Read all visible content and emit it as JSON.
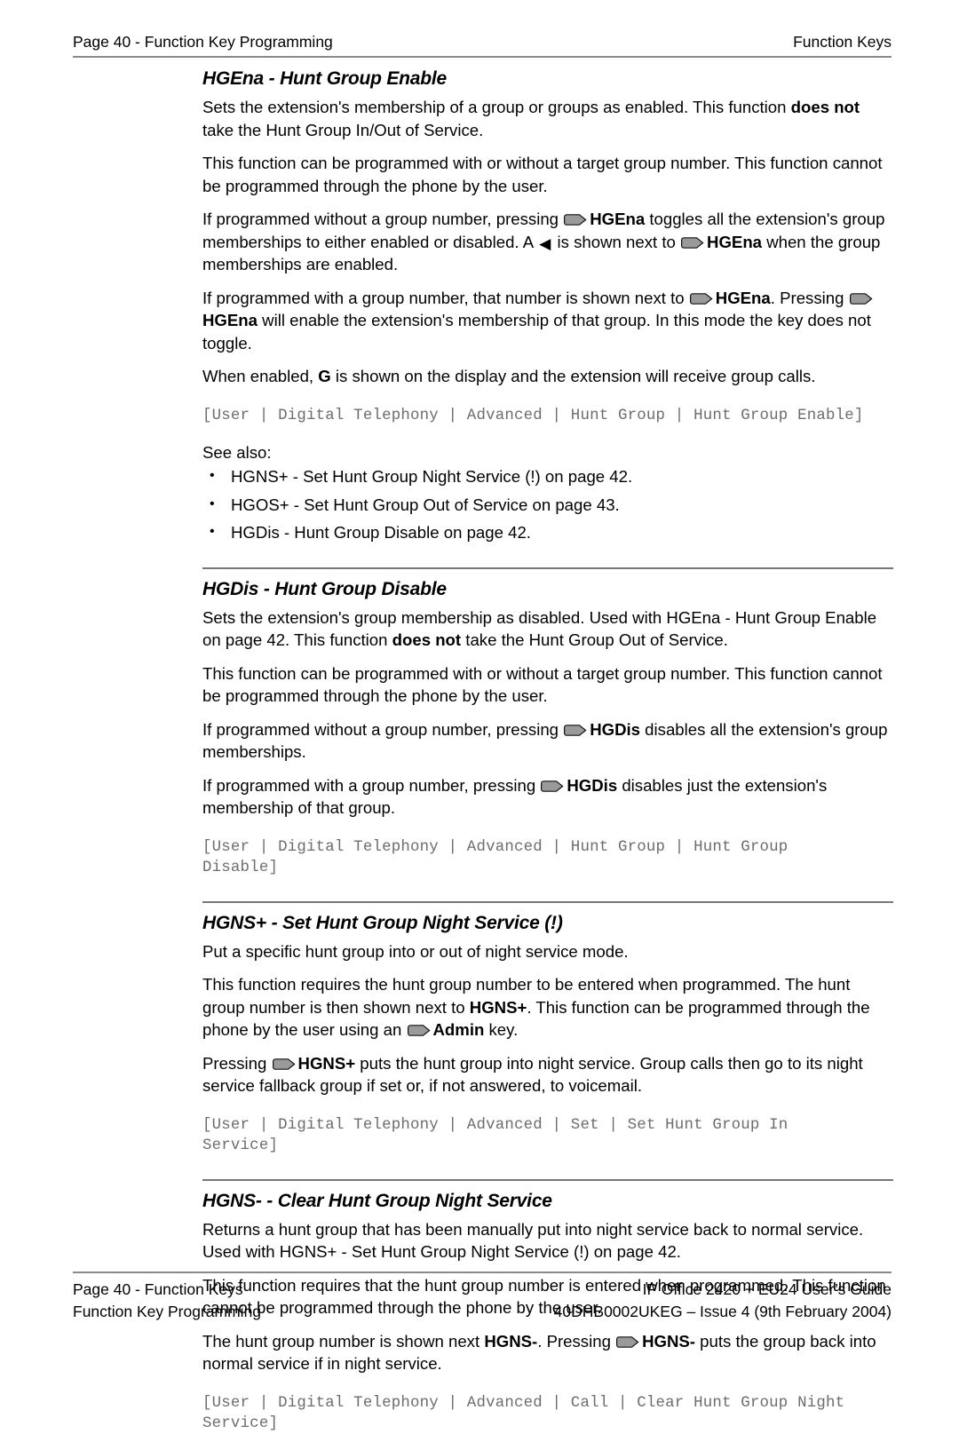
{
  "header": {
    "left": "Page 40 - Function Key Programming",
    "right": "Function Keys"
  },
  "icons": {
    "key": "phone-key-icon",
    "left_arrow": "◀"
  },
  "sections": [
    {
      "title": "HGEna - Hunt Group Enable",
      "p1_a": "Sets the extension's membership of a group or groups as enabled. This function ",
      "p1_b": "does not",
      "p1_c": " take the Hunt Group In/Out of Service.",
      "p2": "This function can be programmed with or without a target group number. This function cannot be programmed through the phone by the user.",
      "p3_a": "If programmed without a group number, pressing ",
      "p3_b": "HGEna",
      "p3_c": " toggles all the extension's group memberships to either enabled or disabled. A ",
      "p3_d": " is shown next to ",
      "p3_e": "HGEna",
      "p3_f": " when the group memberships are enabled.",
      "p4_a": "If programmed with a group number, that number is shown next to ",
      "p4_b": "HGEna",
      "p4_c": ". Pressing ",
      "p4_d": "HGEna",
      "p4_e": " will enable the extension's membership of that group. In this mode the key does not toggle.",
      "p5_a": "When enabled, ",
      "p5_b": "G",
      "p5_c": " is shown on the display and the extension will receive group calls.",
      "path": "[User | Digital Telephony | Advanced | Hunt Group | Hunt Group Enable]",
      "see_also_label": "See also:",
      "see_also": [
        "HGNS+ - Set Hunt Group Night Service (!) on page 42.",
        "HGOS+ - Set Hunt Group Out of Service on page 43.",
        "HGDis - Hunt Group Disable on page 42."
      ]
    },
    {
      "title": "HGDis - Hunt Group Disable",
      "p1_a": "Sets the extension's group membership as disabled. Used with HGEna - Hunt Group Enable on page 42. This function ",
      "p1_b": "does not",
      "p1_c": " take the Hunt Group Out of Service.",
      "p2": "This function can be programmed with or without a target group number. This function cannot be programmed through the phone by the user.",
      "p3_a": "If programmed without a group number, pressing ",
      "p3_b": "HGDis",
      "p3_c": " disables all the extension's group memberships.",
      "p4_a": "If programmed with a group number, pressing ",
      "p4_b": "HGDis",
      "p4_c": " disables just the extension's membership of that group.",
      "path": "[User | Digital Telephony | Advanced | Hunt Group | Hunt Group\nDisable]"
    },
    {
      "title": "HGNS+ - Set Hunt Group Night Service (!)",
      "p1": "Put a specific hunt group into or out of night service mode.",
      "p2_a": "This function requires the hunt group number to be entered when programmed. The hunt group number is then shown next to ",
      "p2_b": "HGNS+",
      "p2_c": ". This function can be programmed through the phone by the user using an ",
      "p2_d": "Admin",
      "p2_e": " key.",
      "p3_a": "Pressing ",
      "p3_b": "HGNS+",
      "p3_c": " puts the hunt group into night service. Group calls then go to its night service fallback group if set or, if not answered, to voicemail.",
      "path": "[User | Digital Telephony | Advanced | Set | Set Hunt Group In\nService]"
    },
    {
      "title": "HGNS- - Clear Hunt Group Night Service",
      "p1": "Returns a hunt group that has been manually put into night service back to normal service. Used with HGNS+ - Set Hunt Group Night Service (!) on page 42.",
      "p2": "This function requires that the hunt group number is entered when programmed. This function cannot be programmed through the phone by the user.",
      "p3_a": "The hunt group number is shown next ",
      "p3_b": "HGNS-",
      "p3_c": ". Pressing ",
      "p3_d": "HGNS-",
      "p3_e": " puts the group back into normal service if in night service.",
      "path": "[User | Digital Telephony | Advanced | Call | Clear Hunt Group Night\nService]"
    }
  ],
  "footer": {
    "left_line1": "Page 40 - Function Keys",
    "left_line2": "Function Key Programming",
    "right_line1": "IP Office 2420 + EU24 User’s Guide",
    "right_line2": "40DHB0002UKEG – Issue 4 (9th February 2004)"
  },
  "colors": {
    "rule": "#8a8a8a",
    "path_text": "#6d6d6d",
    "key_icon_fill": "#9a9a9a"
  }
}
